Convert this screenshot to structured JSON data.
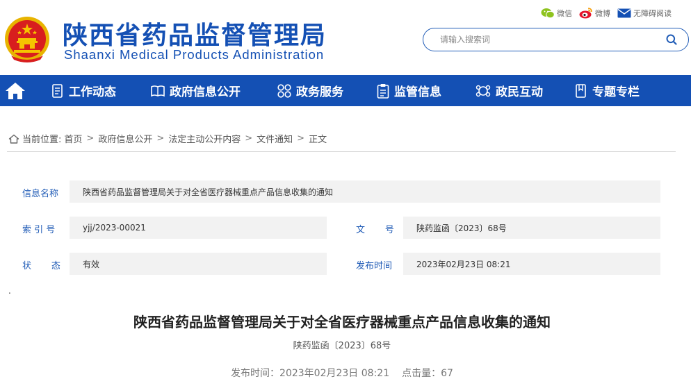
{
  "header": {
    "title_cn": "陕西省药品监督管理局",
    "title_en": "Shaanxi Medical Products Administration",
    "social": {
      "wechat_label": "微信",
      "weibo_label": "微博",
      "accessibility_label": "无障碍阅读"
    },
    "search": {
      "placeholder": "请输入搜索词"
    }
  },
  "nav": {
    "items": [
      {
        "label": "工作动态",
        "icon": "document-icon"
      },
      {
        "label": "政府信息公开",
        "icon": "book-icon"
      },
      {
        "label": "政务服务",
        "icon": "grid-icon"
      },
      {
        "label": "监管信息",
        "icon": "clipboard-icon"
      },
      {
        "label": "政民互动",
        "icon": "interaction-icon"
      },
      {
        "label": "专题专栏",
        "icon": "bookmark-icon"
      }
    ]
  },
  "breadcrumb": {
    "prefix": "当前位置:",
    "items": [
      "首页",
      "政府信息公开",
      "法定主动公开内容",
      "文件通知",
      "正文"
    ]
  },
  "info": {
    "name_label": "信息名称",
    "name_value": "陕西省药品监督管理局关于对全省医疗器械重点产品信息收集的通知",
    "index_label": "索 引 号",
    "index_value": "yjj/2023-00021",
    "doc_no_label": "文       号",
    "doc_no_value": "陕药监函〔2023〕68号",
    "status_label": "状       态",
    "status_value": "有效",
    "date_label": "发布时间",
    "date_value": "2023年02月23日 08:21"
  },
  "article": {
    "dot": ".",
    "title": "陕西省药品监督管理局关于对全省医疗器械重点产品信息收集的通知",
    "doc_no": "陕药监函〔2023〕68号",
    "publish_label": "发布时间：2023年02月23日 08:21",
    "clicks_label": "点击量：67"
  },
  "colors": {
    "brand_blue": "#1450b4",
    "label_blue": "#1f5bb6",
    "emblem_red": "#d81e1e",
    "emblem_gold": "#f5c400"
  }
}
